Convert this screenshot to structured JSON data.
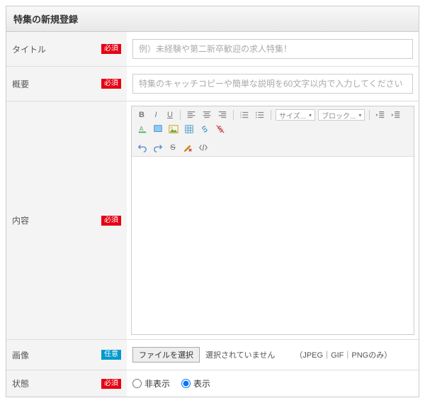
{
  "header": {
    "title": "特集の新規登録"
  },
  "badges": {
    "required": "必須",
    "optional": "任意"
  },
  "fields": {
    "title": {
      "label": "タイトル",
      "placeholder": "例）未経験や第二新卒歓迎の求人特集！"
    },
    "summary": {
      "label": "概要",
      "placeholder": "特集のキャッチコピーや簡単な説明を60文字以内で入力してください"
    },
    "content": {
      "label": "内容"
    },
    "image": {
      "label": "画像",
      "choose_button": "ファイルを選択",
      "no_file": "選択されていません",
      "note": "（JPEG｜GIF｜PNGのみ）"
    },
    "status": {
      "label": "状態",
      "hidden": "非表示",
      "shown": "表示",
      "selected": "shown"
    }
  },
  "editor": {
    "size_label": "サイズ...",
    "block_label": "ブロック...",
    "icons": {
      "bold": "B",
      "italic": "I",
      "underline": "U",
      "strike": "S"
    }
  }
}
